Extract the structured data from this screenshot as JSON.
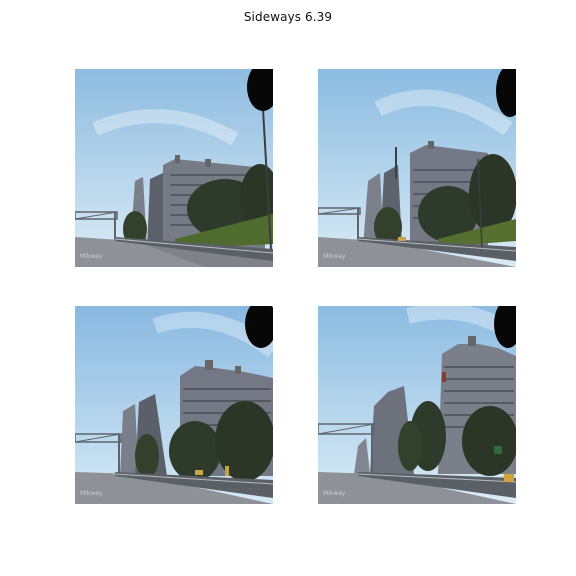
{
  "figure": {
    "title": "Sideways 6.39"
  },
  "panels": [
    {
      "name": "frame-1",
      "watermark": "Mikway"
    },
    {
      "name": "frame-2",
      "watermark": "Mikway"
    },
    {
      "name": "frame-3",
      "watermark": "Mikway"
    },
    {
      "name": "frame-4",
      "watermark": "Mikway"
    }
  ],
  "colors": {
    "sky_top": "#9ec8e6",
    "sky_bottom": "#d9ebf5",
    "building": "#6f7480",
    "building_dark": "#3c4049",
    "trees": "#2f3b2a",
    "grass": "#4f6b2e",
    "road": "#8d9097",
    "barrier": "#5b5f66"
  }
}
